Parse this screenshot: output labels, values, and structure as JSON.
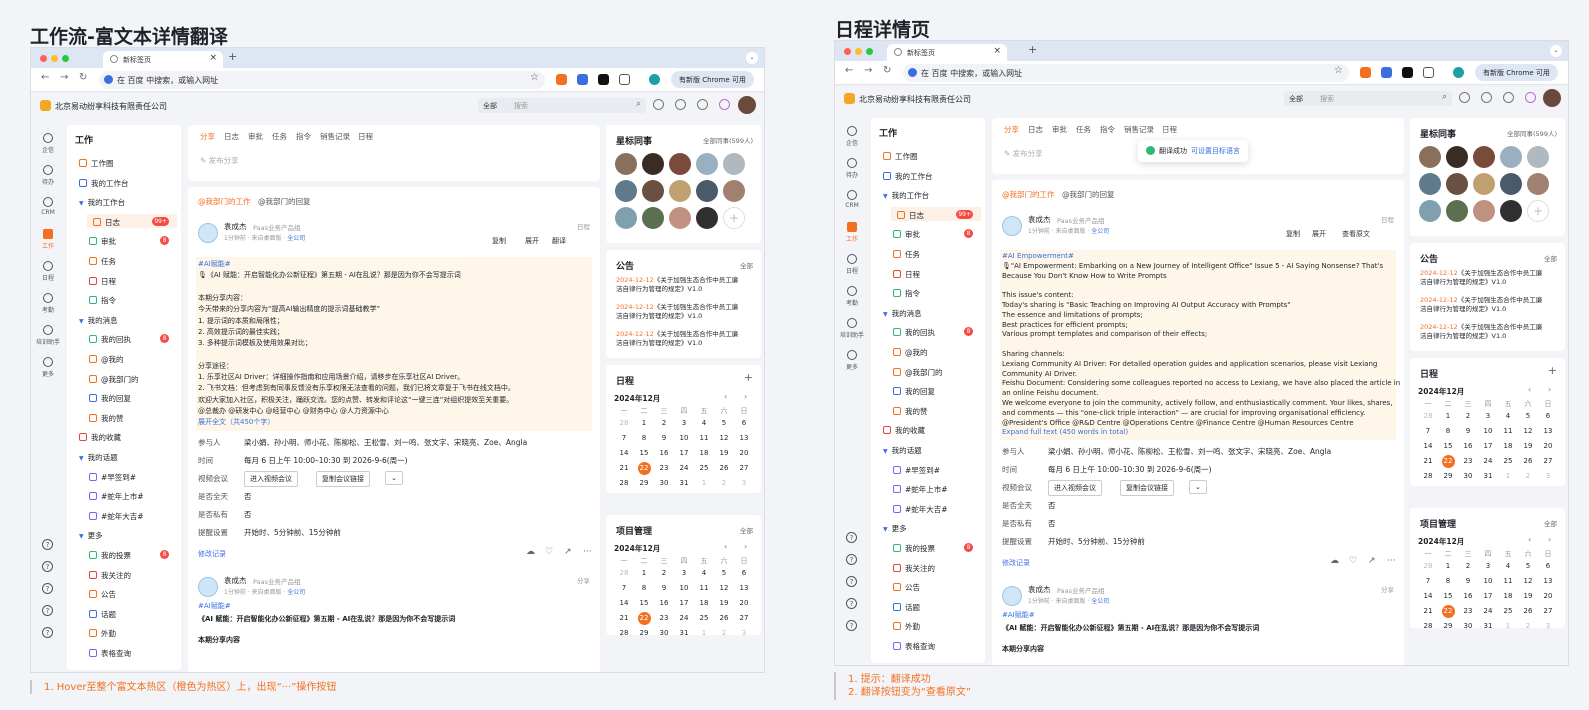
{
  "titles": {
    "left": "工作流-富文本详情翻译",
    "right": "日程详情页"
  },
  "notes": {
    "left": "1. Hover至整个富文本热区（橙色为热区）上，出现“···”操作按钮",
    "right_1": "1. 提示：翻译成功",
    "right_2": "2. 翻译按钮变为“查看原文”"
  },
  "browser": {
    "tab_label": "新标签页",
    "address_placeholder": "在 百度 中搜索，或输入网址",
    "new_chrome": "有新版 Chrome 可用"
  },
  "app": {
    "company": "北京易动纷享科技有限责任公司",
    "search_scope": "全部",
    "search_placeholder": "搜索"
  },
  "rail": [
    "企信",
    "待办",
    "CRM",
    "工作",
    "日程",
    "考勤",
    "培训助手",
    "更多"
  ],
  "sidenav": {
    "title": "工作",
    "items_left": [
      "工作圈",
      "我的工作台",
      "我的工作台",
      "日志",
      "审批",
      "任务",
      "日程",
      "指令",
      "我的消息",
      "我的回执",
      "@我的",
      "@我部门的",
      "我的回复",
      "我的赞",
      "我的收藏",
      "我的话题",
      "#早签到#",
      "#蛇年上市#",
      "#蛇年大吉#",
      "更多",
      "我的投票",
      "我关注的",
      "公告",
      "话题",
      "外勤",
      "表格查询"
    ],
    "items_right": [
      "工作圈",
      "我的工作台",
      "我的工作台",
      "日志",
      "审批",
      "任务",
      "日程",
      "指令",
      "我的消息",
      "我的回执",
      "@我的",
      "@我部门的",
      "我的回复",
      "我的赞",
      "我的收藏",
      "我的话题",
      "#早签到#",
      "#蛇年上市#",
      "#蛇年大吉#",
      "更多",
      "我的投票",
      "我关注的",
      "公告",
      "话题",
      "外勤",
      "表格查询"
    ],
    "badge_log": "99+",
    "badge_small": "8"
  },
  "feed": {
    "tabs": [
      "分享",
      "日志",
      "审批",
      "任务",
      "指令",
      "销售记录",
      "日程"
    ],
    "compose": "发布分享",
    "filter_1": "@我部门的工作",
    "filter_2": "@我部门的回复",
    "author": "袁成杰",
    "dept": "Paas业务产品组",
    "meta_time": "1分钟前 · 来自桌面版 · ",
    "meta_scope": "全公司",
    "tag_schedule": "日程",
    "tag_share": "分享",
    "btn_copy": "复制",
    "btn_expand": "展开",
    "btn_translate": "翻译",
    "btn_original": "查看原文",
    "edit_record": "修改记录",
    "post2_title": "《AI 赋能：开启智能化办公新征程》第五期 - AI在乱说？那是因为你不会写提示词",
    "post2_sub": "本期分享内容"
  },
  "cn_text": [
    "#AI赋能#",
    "🎙《AI 赋能：开启智能化办公新征程》第五期 - AI在乱说？那是因为你不会写提示词",
    "",
    "本期分享内容：",
    "今天带来的分享内容为“提高AI输出精度的提示词基础教学”",
    " 1. 提示词的本质和局限性；",
    " 2. 高效提示词的最佳实践；",
    " 3. 多种提示词模板及使用效果对比；",
    "",
    "分享途径：",
    " 1. 乐享社区AI Driver：详细操作指南和应用场景介绍，请移步在乐享社区AI Driver。",
    " 2. 飞书文档：但考虑到有同事反馈没有乐享权限无法查看的问题，我们已将文章复于飞书在线文档中。",
    "欢迎大家加入社区，积极关注，踊跃交流。您的点赞、转发和评论这“一键三连”对组织提效至关重要。",
    "@总裁办 @研发中心 @经营中心 @财务中心 @人力资源中心",
    "展开全文（共450个字）"
  ],
  "en_text": [
    "#AI Empowerment#",
    "🎙\"AI Empowerment: Embarking on a New Journey of Intelligent Office\" Issue 5 - AI Saying Nonsense? That's",
    "Because You Don't Know How to Write Prompts",
    "",
    "This issue's content:",
    "Today's sharing is \"Basic Teaching on Improving AI Output Accuracy with Prompts\"",
    "The essence and limitations of prompts;",
    "Best practices for efficient prompts;",
    "Various prompt templates and comparison of their effects;",
    "",
    "Sharing channels:",
    "Lexiang Community AI Driver: For detailed operation guides and application scenarios, please visit Lexiang",
    "Community AI Driver.",
    "Feishu Document: Considering some colleagues reported no access to Lexiang, we have also placed the article in",
    "an online Feishu document.",
    "We welcome everyone to join the community, actively follow, and enthusiastically comment. Your likes, shares,",
    "and comments — this \"one-click triple interaction\" — are crucial for improving organisational efficiency.",
    "@President's Office @R&D Centre @Operations Centre @Finance Centre @Human Resources Centre",
    "Expand full text (450 words in total)"
  ],
  "schedule": {
    "participants_k": "参与人",
    "participants_v": "梁小娟、孙小明、师小花、陈柳松、王松雪、刘一鸣、张文字、宋晓亮、Zoe、Angla",
    "time_k": "时间",
    "time_v": "每月 6 日上午 10:00–10:30 到 2026-9-6(周一)",
    "video_k": "视频会议",
    "video_join": "进入视频会议",
    "video_copy": "复制会议链接",
    "allday_k": "是否全天",
    "allday_v": "否",
    "private_k": "是否私有",
    "private_v": "否",
    "remind_k": "提醒设置",
    "remind_v": "开始时、5分钟前、15分钟前"
  },
  "right_panel": {
    "star_title": "星标同事",
    "star_more": "全部同事(599人)",
    "notice_title": "公告",
    "notice_more": "全部",
    "notice_date": "2024-12-12",
    "notice_text_1": "《关于加强生态合作中员工廉",
    "notice_text_2": "洁自律行为管理的规定》V1.0",
    "schedule_title": "日程",
    "project_title": "项目管理",
    "project_more": "全部",
    "month": "2024年12月",
    "weekdays": [
      "一",
      "二",
      "三",
      "四",
      "五",
      "六",
      "日"
    ],
    "days": [
      "28",
      "1",
      "2",
      "3",
      "4",
      "5",
      "6",
      "7",
      "8",
      "9",
      "10",
      "11",
      "12",
      "13",
      "14",
      "15",
      "16",
      "17",
      "18",
      "19",
      "20",
      "21",
      "22",
      "23",
      "24",
      "25",
      "26",
      "27",
      "28",
      "29",
      "30",
      "31",
      "1",
      "2",
      "3"
    ],
    "today": "22"
  },
  "toast": {
    "text": "翻译成功",
    "link": "可设置目标语言"
  },
  "colors": {
    "accent": "#f37021",
    "link": "#3b6fe0",
    "hot": "#fdf6e9"
  }
}
